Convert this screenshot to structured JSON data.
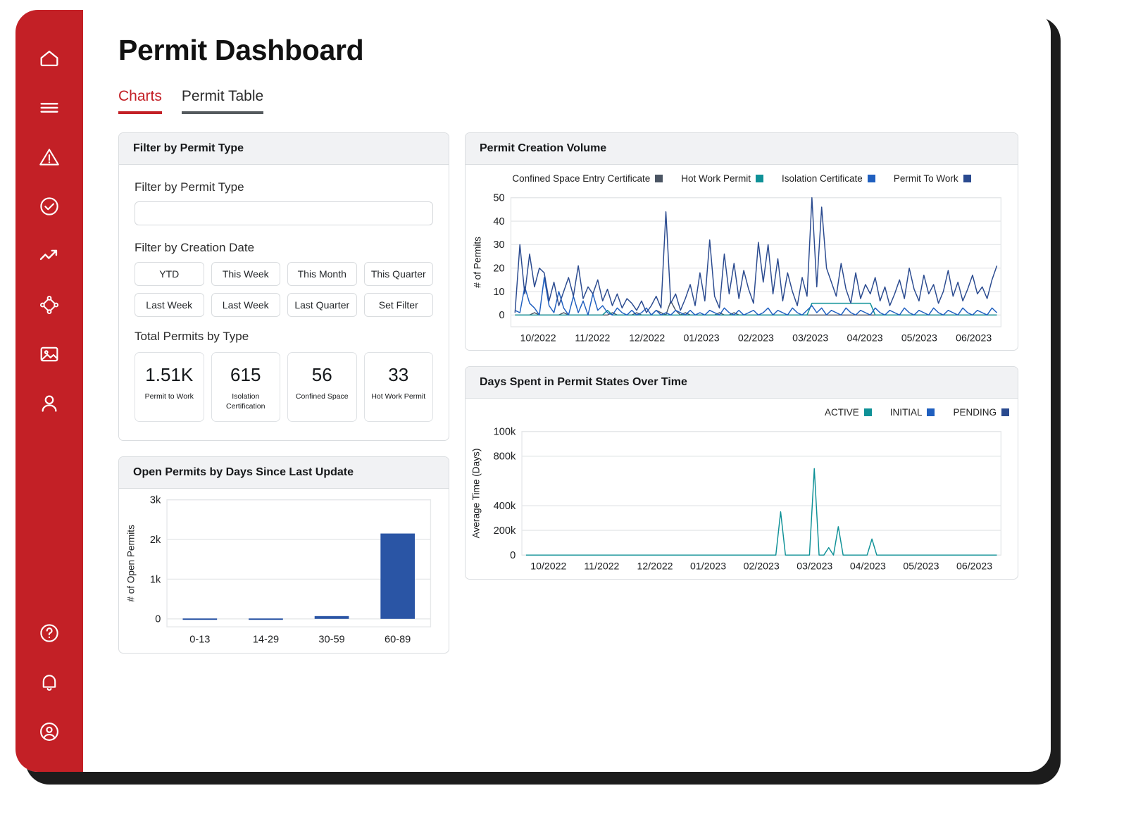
{
  "app": {
    "title": "Permit Dashboard",
    "accent_color": "#c32026",
    "sidebar_color": "#c32026"
  },
  "sidebar": {
    "items": [
      {
        "icon": "home-icon",
        "name": "home"
      },
      {
        "icon": "menu-icon",
        "name": "menu"
      },
      {
        "icon": "warning-triangle-icon",
        "name": "alerts"
      },
      {
        "icon": "check-circle-icon",
        "name": "approvals"
      },
      {
        "icon": "trending-up-icon",
        "name": "analytics"
      },
      {
        "icon": "network-nodes-icon",
        "name": "network"
      },
      {
        "icon": "image-icon",
        "name": "media"
      },
      {
        "icon": "person-icon",
        "name": "people"
      }
    ],
    "bottom_items": [
      {
        "icon": "help-circle-icon",
        "name": "help"
      },
      {
        "icon": "bell-icon",
        "name": "notifications"
      },
      {
        "icon": "account-circle-icon",
        "name": "account"
      }
    ]
  },
  "tabs": [
    {
      "label": "Charts",
      "active": true
    },
    {
      "label": "Permit Table",
      "active": false
    }
  ],
  "filter_panel": {
    "header": "Filter by Permit Type",
    "permit_type_label": "Filter by Permit Type",
    "permit_type_value": "",
    "permit_type_placeholder": "",
    "creation_date_label": "Filter by Creation Date",
    "date_buttons_row1": [
      "YTD",
      "This Week",
      "This Month",
      "This Quarter"
    ],
    "date_buttons_row2": [
      "Last Week",
      "Last Week",
      "Last Quarter",
      "Set Filter"
    ],
    "totals_label": "Total Permits by Type",
    "kpis": [
      {
        "value": "1.51K",
        "label": "Permit to Work"
      },
      {
        "value": "615",
        "label": "Isolation Certification"
      },
      {
        "value": "56",
        "label": "Confined Space"
      },
      {
        "value": "33",
        "label": "Hot Work Permit"
      }
    ]
  },
  "open_permits_panel": {
    "header": "Open Permits by Days Since Last Update"
  },
  "creation_volume_panel": {
    "header": "Permit Creation Volume"
  },
  "days_states_panel": {
    "header": "Days Spent in Permit States Over Time"
  },
  "chart_data": [
    {
      "id": "permit-creation-volume",
      "type": "line",
      "title": "Permit Creation Volume",
      "xlabel": "",
      "ylabel": "# of Permits",
      "ylim": [
        -5,
        50
      ],
      "yticks": [
        0,
        10,
        20,
        30,
        40,
        50
      ],
      "ytick_labels": [
        "0",
        "10",
        "20",
        "30",
        "40",
        "50"
      ],
      "xtick_labels": [
        "10/2022",
        "11/2022",
        "12/2022",
        "01/2023",
        "02/2023",
        "03/2023",
        "04/2023",
        "05/2023",
        "06/2023"
      ],
      "grid": true,
      "legend_position": "top-center",
      "series": [
        {
          "name": "Confined Space Entry Certificate",
          "color": "#4b5563",
          "values": [
            0,
            0,
            0,
            0,
            1,
            0,
            0,
            0,
            0,
            0,
            1,
            0,
            0,
            0,
            0,
            0,
            0,
            0,
            0,
            0,
            1,
            0,
            0,
            0,
            0,
            1,
            0,
            0,
            0,
            2,
            1,
            0,
            6,
            2,
            0,
            1,
            0,
            0,
            0,
            0,
            0,
            0,
            1,
            0,
            0,
            1,
            0,
            0,
            0,
            0,
            0,
            0,
            0,
            0,
            0,
            0,
            0,
            0,
            0,
            0,
            0,
            0,
            0,
            0,
            0,
            0,
            0,
            0,
            0,
            0,
            0,
            0,
            0,
            0,
            0,
            0,
            0,
            0,
            0,
            0,
            0,
            0,
            0,
            0,
            0,
            0,
            0,
            0,
            0,
            0,
            0,
            0,
            0,
            0,
            0,
            0,
            0,
            0,
            0,
            0
          ]
        },
        {
          "name": "Hot Work Permit",
          "color": "#0f9197",
          "values": [
            0,
            0,
            0,
            0,
            0,
            0,
            0,
            0,
            0,
            0,
            0,
            0,
            0,
            0,
            0,
            0,
            0,
            0,
            0,
            2,
            0,
            0,
            0,
            0,
            0,
            0,
            0,
            0,
            0,
            0,
            0,
            0,
            0,
            0,
            0,
            0,
            0,
            0,
            0,
            0,
            0,
            0,
            0,
            0,
            0,
            0,
            0,
            0,
            0,
            0,
            0,
            0,
            0,
            0,
            0,
            0,
            0,
            0,
            0,
            0,
            0,
            5,
            5,
            5,
            5,
            5,
            5,
            5,
            5,
            5,
            5,
            5,
            5,
            5,
            0,
            0,
            0,
            0,
            0,
            0,
            0,
            0,
            0,
            0,
            0,
            0,
            0,
            0,
            0,
            0,
            0,
            0,
            0,
            0,
            0,
            0,
            0,
            0,
            0,
            0
          ]
        },
        {
          "name": "Isolation Certificate",
          "color": "#1f5fbf",
          "values": [
            2,
            1,
            12,
            5,
            3,
            0,
            16,
            4,
            1,
            10,
            3,
            0,
            8,
            1,
            6,
            0,
            9,
            2,
            4,
            1,
            0,
            3,
            1,
            0,
            2,
            0,
            1,
            3,
            0,
            2,
            0,
            1,
            0,
            2,
            1,
            0,
            2,
            0,
            1,
            0,
            2,
            1,
            0,
            3,
            1,
            0,
            2,
            0,
            1,
            2,
            0,
            1,
            3,
            0,
            2,
            1,
            0,
            3,
            1,
            0,
            2,
            4,
            1,
            3,
            0,
            2,
            1,
            0,
            3,
            1,
            0,
            2,
            1,
            0,
            3,
            1,
            0,
            2,
            1,
            0,
            3,
            1,
            0,
            2,
            1,
            0,
            3,
            1,
            0,
            2,
            1,
            0,
            3,
            1,
            0,
            2,
            1,
            0,
            3,
            1
          ]
        },
        {
          "name": "Permit To Work",
          "color": "#2a4a8f",
          "values": [
            1,
            30,
            9,
            26,
            12,
            20,
            18,
            6,
            14,
            4,
            10,
            16,
            8,
            21,
            7,
            12,
            9,
            15,
            6,
            11,
            4,
            9,
            3,
            7,
            5,
            2,
            6,
            1,
            4,
            8,
            3,
            44,
            5,
            9,
            2,
            7,
            13,
            4,
            18,
            6,
            32,
            8,
            3,
            26,
            9,
            22,
            7,
            19,
            11,
            5,
            31,
            14,
            30,
            9,
            24,
            6,
            18,
            10,
            4,
            16,
            8,
            50,
            12,
            46,
            20,
            14,
            8,
            22,
            11,
            5,
            18,
            7,
            13,
            9,
            16,
            6,
            12,
            4,
            9,
            15,
            7,
            20,
            11,
            6,
            17,
            9,
            13,
            5,
            10,
            19,
            8,
            14,
            6,
            11,
            17,
            9,
            12,
            7,
            15,
            21
          ]
        }
      ]
    },
    {
      "id": "open-permits-by-days",
      "type": "bar",
      "title": "Open Permits by Days Since Last Update",
      "xlabel": "",
      "ylabel": "# of Open Permits",
      "ylim": [
        -200,
        3000
      ],
      "yticks": [
        0,
        1000,
        2000,
        3000
      ],
      "ytick_labels": [
        "0",
        "1k",
        "2k",
        "3k"
      ],
      "categories": [
        "0-13",
        "14-29",
        "30-59",
        "60-89"
      ],
      "values": [
        10,
        10,
        70,
        2150
      ],
      "bar_color": "#2a55a5",
      "grid": true
    },
    {
      "id": "days-spent-in-permit-states",
      "type": "line",
      "title": "Days Spent in Permit States Over Time",
      "xlabel": "",
      "ylabel": "Average Time (Days)",
      "ylim": [
        0,
        1000000
      ],
      "yticks": [
        0,
        200000,
        400000,
        800000,
        1000000
      ],
      "ytick_labels": [
        "0",
        "200k",
        "400k",
        "800k",
        "100k"
      ],
      "xtick_labels": [
        "10/2022",
        "11/2022",
        "12/2022",
        "01/2023",
        "02/2023",
        "03/2023",
        "04/2023",
        "05/2023",
        "06/2023"
      ],
      "grid": true,
      "legend_position": "top-right",
      "series": [
        {
          "name": "ACTIVE",
          "color": "#0f9197",
          "values": [
            0,
            0,
            0,
            0,
            0,
            0,
            0,
            0,
            0,
            0,
            0,
            0,
            0,
            0,
            0,
            0,
            0,
            0,
            0,
            0,
            0,
            0,
            0,
            0,
            0,
            0,
            0,
            0,
            0,
            0,
            0,
            0,
            0,
            0,
            0,
            0,
            0,
            0,
            0,
            0,
            0,
            0,
            0,
            0,
            0,
            0,
            0,
            0,
            0,
            0,
            0,
            0,
            0,
            350000,
            0,
            0,
            0,
            0,
            0,
            0,
            700000,
            0,
            0,
            60000,
            0,
            230000,
            0,
            0,
            0,
            0,
            0,
            0,
            130000,
            0,
            0,
            0,
            0,
            0,
            0,
            0,
            0,
            0,
            0,
            0,
            0,
            0,
            0,
            0,
            0,
            0,
            0,
            0,
            0,
            0,
            0,
            0,
            0,
            0,
            0
          ]
        },
        {
          "name": "INITIAL",
          "color": "#1f5fbf",
          "values": []
        },
        {
          "name": "PENDING",
          "color": "#2a4a8f",
          "values": []
        }
      ]
    }
  ]
}
